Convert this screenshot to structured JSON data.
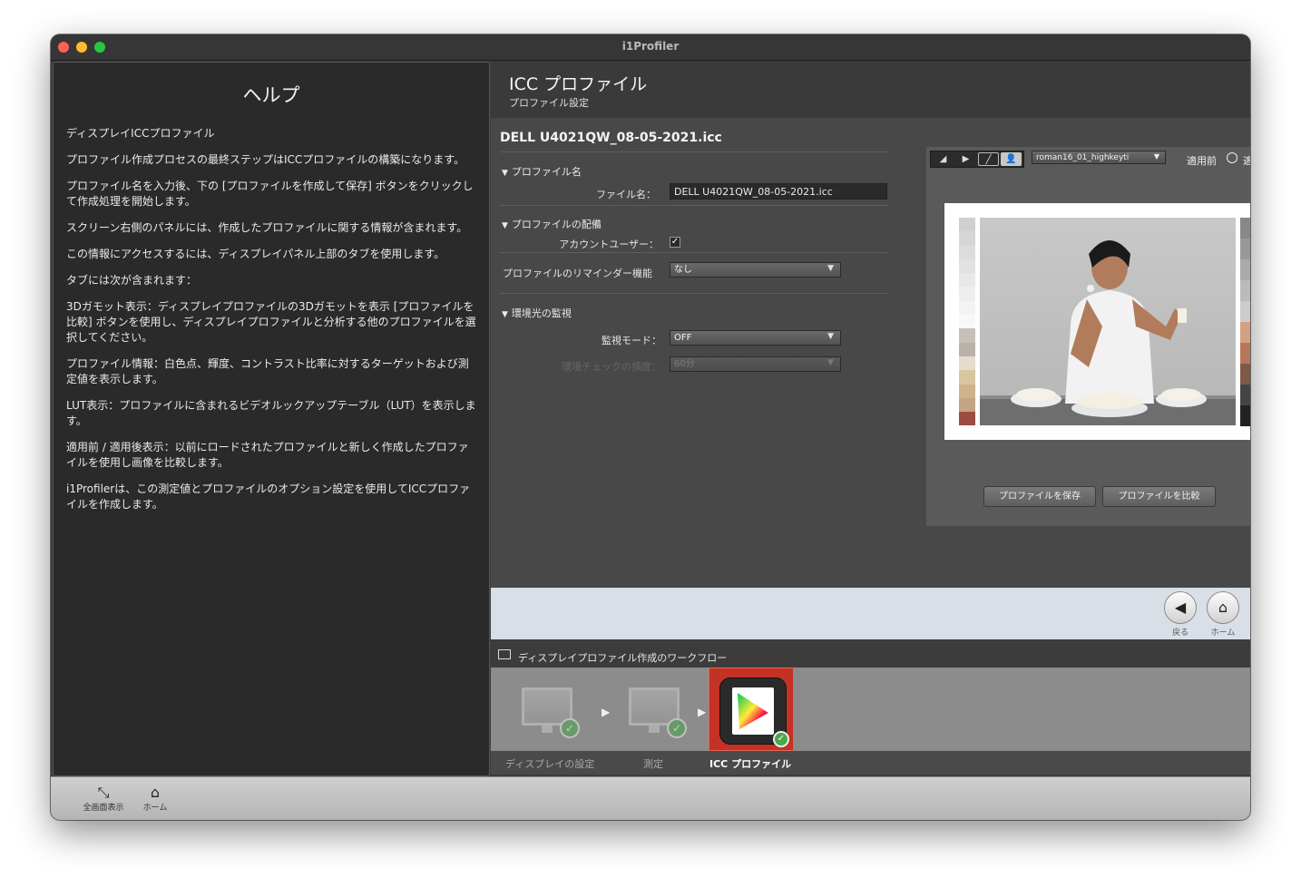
{
  "window": {
    "title": "i1Profiler"
  },
  "help": {
    "heading": "ヘルプ",
    "paragraphs": [
      "ディスプレイICCプロファイル",
      "プロファイル作成プロセスの最終ステップはICCプロファイルの構築になります。",
      "プロファイル名を入力後、下の [プロファイルを作成して保存] ボタンをクリックして作成処理を開始します。",
      "スクリーン右側のパネルには、作成したプロファイルに関する情報が含まれます。",
      "この情報にアクセスするには、ディスプレイパネル上部のタブを使用します。",
      "タブには次が含まれます：",
      "3Dガモット表示：ディスプレイプロファイルの3Dガモットを表示 [プロファイルを比較] ボタンを使用し、ディスプレイプロファイルと分析する他のプロファイルを選択してください。",
      "プロファイル情報：白色点、輝度、コントラスト比率に対するターゲットおよび測定値を表示します。",
      "LUT表示：プロファイルに含まれるビデオルックアップテーブル（LUT）を表示します。",
      "適用前 / 適用後表示：以前にロードされたプロファイルと新しく作成したプロファイルを使用し画像を比較します。",
      "i1Profilerは、この測定値とプロファイルのオプション設定を使用してICCプロファイルを作成します。"
    ]
  },
  "header": {
    "title": "ICC プロファイル",
    "subtitle": "プロファイル設定"
  },
  "profile": {
    "filename_title": "DELL U4021QW_08-05-2021.icc",
    "section_name": "プロファイル名",
    "file_label": "ファイル名：",
    "file_value": "DELL U4021QW_08-05-2021.icc",
    "section_distribution": "プロファイルの配備",
    "account_label": "アカウントユーザー：",
    "reminder_label": "プロファイルのリマインダー機能",
    "reminder_value": "なし",
    "section_ambient": "環境光の監視",
    "monitor_mode_label": "監視モード：",
    "monitor_mode_value": "OFF",
    "check_freq_label": "環境チェックの頻度：",
    "check_freq_value": "60分"
  },
  "preview": {
    "image_select": "roman16_01_highkeyti",
    "before_label": "適用前",
    "after_label": "適用後",
    "save_button": "プロファイルを保存",
    "compare_button": "プロファイルを比較"
  },
  "nav": {
    "back_label": "戻る",
    "home_label": "ホーム"
  },
  "workflow": {
    "title": "ディスプレイプロファイル作成のワークフロー",
    "steps": [
      "ディスプレイの設定",
      "測定",
      "ICC プロファイル"
    ]
  },
  "bottom": {
    "fullscreen_label": "全画面表示",
    "home_label": "ホーム"
  }
}
